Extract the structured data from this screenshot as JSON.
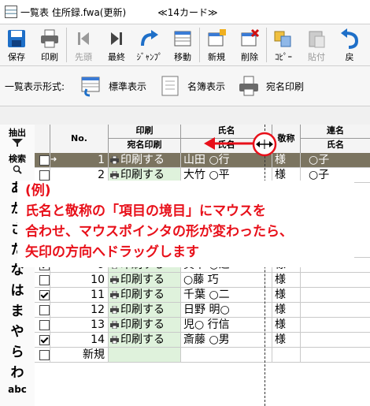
{
  "window": {
    "title": "一覧表 住所録.fwa(更新)",
    "card_count": "≪14カード≫"
  },
  "toolbar": {
    "buttons": [
      {
        "label": "保存",
        "icon": "save-icon",
        "disabled": false
      },
      {
        "label": "印刷",
        "icon": "print-icon",
        "disabled": false
      },
      {
        "label": "先頭",
        "icon": "first-icon",
        "disabled": true
      },
      {
        "label": "最終",
        "icon": "last-icon",
        "disabled": false
      },
      {
        "label": "ｼﾞｬﾝﾌﾟ",
        "icon": "jump-icon",
        "disabled": false
      },
      {
        "label": "移動",
        "icon": "move-icon",
        "disabled": false
      },
      {
        "label": "新規",
        "icon": "new-icon",
        "disabled": false
      },
      {
        "label": "削除",
        "icon": "delete-icon",
        "disabled": false
      },
      {
        "label": "ｺﾋﾟｰ",
        "icon": "copy-icon",
        "disabled": false
      },
      {
        "label": "貼付",
        "icon": "paste-icon",
        "disabled": true
      },
      {
        "label": "戻",
        "icon": "undo-icon",
        "disabled": false
      }
    ]
  },
  "viewbar": {
    "label": "一覧表示形式:",
    "options": [
      "標準表示",
      "名簿表示",
      "宛名印刷"
    ]
  },
  "sidebar": {
    "extract": "抽出",
    "search": "検索",
    "kana": [
      "あ",
      "か",
      "さ",
      "た",
      "な",
      "は",
      "ま",
      "や",
      "ら",
      "わ"
    ],
    "bottom": "abc"
  },
  "grid": {
    "headers": {
      "no": "No.",
      "print_group": "印刷",
      "print_sub": "宛名印刷",
      "name_group": "氏名",
      "name_sub": "氏名",
      "honorific": "敬称",
      "joint_group": "連名",
      "joint_sub": "氏名"
    },
    "rows": [
      {
        "checked": false,
        "no": "1",
        "print": "印刷する",
        "name": "山田 ○行",
        "hon": "様",
        "joint": "○子",
        "selected": true
      },
      {
        "checked": false,
        "no": "2",
        "print": "印刷する",
        "name": "大竹 ○平",
        "hon": "様",
        "joint": "○子"
      },
      {
        "checked": false,
        "no": "8",
        "print": "印刷する",
        "name": "石○ 俊二",
        "hon": "様",
        "joint": "美○子"
      },
      {
        "checked": true,
        "no": "9",
        "print": "印刷する",
        "name": "真中 ○之",
        "hon": "様",
        "joint": ""
      },
      {
        "checked": false,
        "no": "10",
        "print": "印刷する",
        "name": "○藤 巧",
        "hon": "様",
        "joint": ""
      },
      {
        "checked": true,
        "no": "11",
        "print": "印刷する",
        "name": "千葉 ○二",
        "hon": "様",
        "joint": ""
      },
      {
        "checked": false,
        "no": "12",
        "print": "印刷する",
        "name": "日野 明○",
        "hon": "様",
        "joint": ""
      },
      {
        "checked": false,
        "no": "13",
        "print": "印刷する",
        "name": "児○ 行信",
        "hon": "様",
        "joint": ""
      },
      {
        "checked": true,
        "no": "14",
        "print": "印刷する",
        "name": "斎藤 ○男",
        "hon": "様",
        "joint": ""
      },
      {
        "checked": false,
        "no": "新規",
        "print": "",
        "name": "",
        "hon": "",
        "joint": ""
      }
    ]
  },
  "callout": {
    "line1": "(例)",
    "line2": "氏名と敬称の「項目の境目」にマウスを",
    "line3": "合わせ、マウスポインタの形が変わったら、",
    "line4": "矢印の方向へドラッグします"
  },
  "colors": {
    "accent_red": "#e8101a",
    "selected_row": "#7b7460",
    "print_col_bg": "#dff2dc"
  }
}
